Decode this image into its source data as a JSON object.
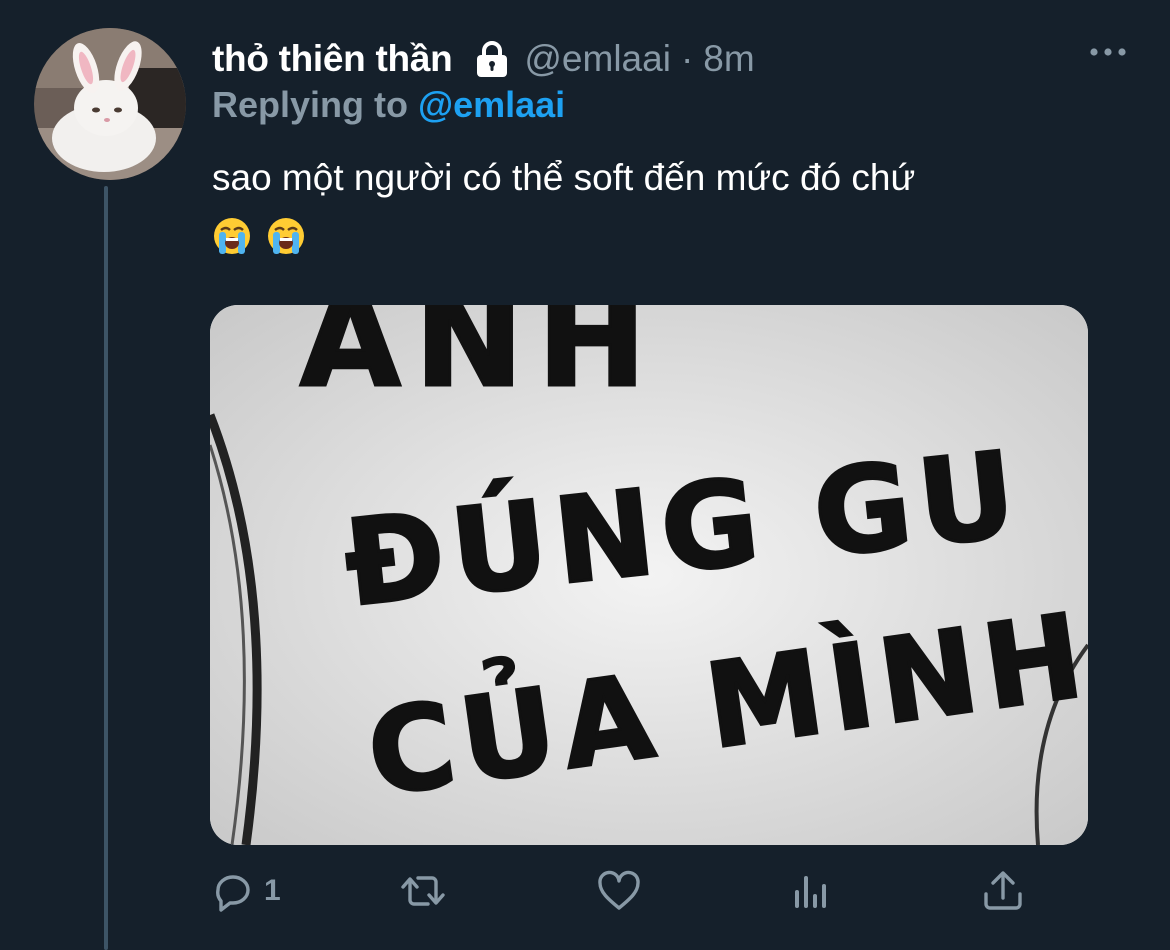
{
  "tweet": {
    "display_name": "thỏ thiên thần",
    "handle": "@emlaai",
    "separator": "·",
    "time": "8m",
    "reply_prefix": "Replying to ",
    "reply_mention": "@emlaai",
    "text": "sao một người có thể soft đến mức đó chứ",
    "emojis": [
      "loudly-crying-face",
      "loudly-crying-face"
    ],
    "media_text": {
      "line1": "ANH",
      "line2": "ĐÚNG GU",
      "line3": "CỦA MÌNH"
    }
  },
  "actions": {
    "reply_count": "1",
    "retweet_count": "",
    "like_count": ""
  },
  "icons": [
    "lock-icon",
    "more-icon",
    "reply-icon",
    "retweet-icon",
    "like-icon",
    "analytics-icon",
    "share-icon"
  ],
  "colors": {
    "background": "#15202b",
    "text": "#ffffff",
    "muted": "#8899a6",
    "accent": "#1da1f2",
    "thread_line": "#3d5466"
  }
}
